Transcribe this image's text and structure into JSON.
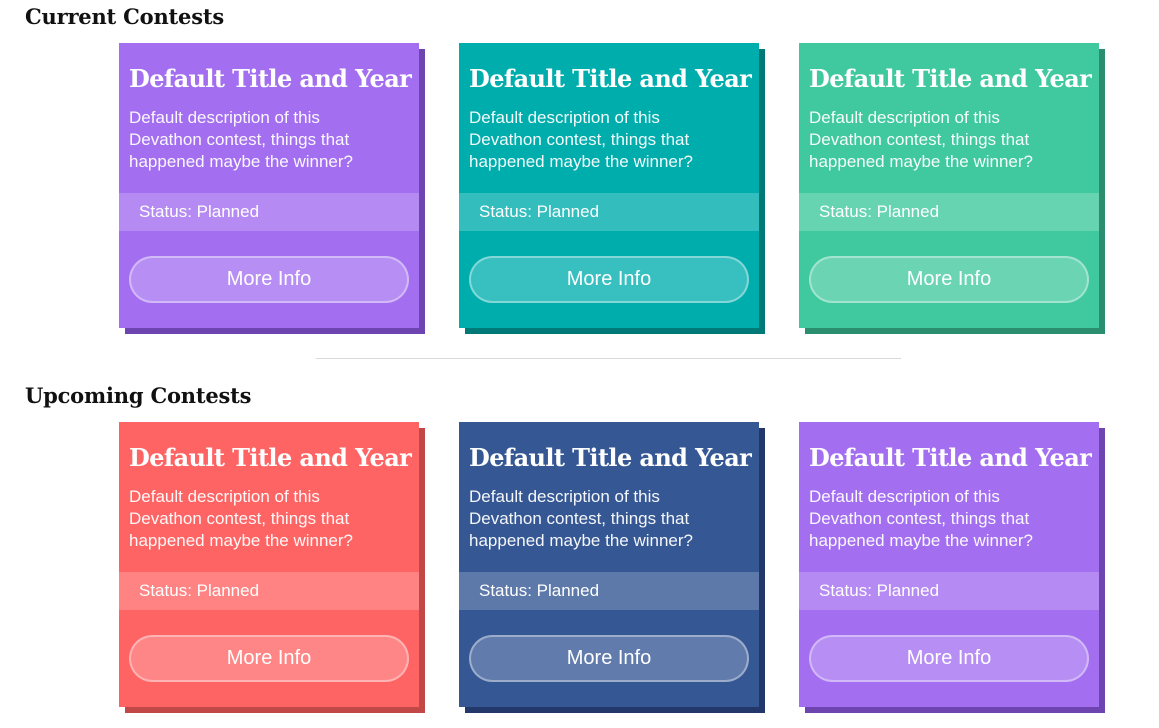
{
  "sections": [
    {
      "title": "Current Contests",
      "cards": [
        {
          "title": "Default Title and Year",
          "description": "Default description of this Devathon contest, things that happened maybe the winner?",
          "status": "Status: Planned",
          "button_label": "More Info",
          "color": "#a36ff0"
        },
        {
          "title": "Default Title and Year",
          "description": "Default description of this Devathon contest, things that happened maybe the winner?",
          "status": "Status: Planned",
          "button_label": "More Info",
          "color": "#00adad"
        },
        {
          "title": "Default Title and Year",
          "description": "Default description of this Devathon contest, things that happened maybe the winner?",
          "status": "Status: Planned",
          "button_label": "More Info",
          "color": "#40c89e"
        }
      ]
    },
    {
      "title": "Upcoming Contests",
      "cards": [
        {
          "title": "Default Title and Year",
          "description": "Default description of this Devathon contest, things that happened maybe the winner?",
          "status": "Status: Planned",
          "button_label": "More Info",
          "color": "#ff6464"
        },
        {
          "title": "Default Title and Year",
          "description": "Default description of this Devathon contest, things that happened maybe the winner?",
          "status": "Status: Planned",
          "button_label": "More Info",
          "color": "#355895"
        },
        {
          "title": "Default Title and Year",
          "description": "Default description of this Devathon contest, things that happened maybe the winner?",
          "status": "Status: Planned",
          "button_label": "More Info",
          "color": "#a36ff0"
        }
      ]
    }
  ]
}
